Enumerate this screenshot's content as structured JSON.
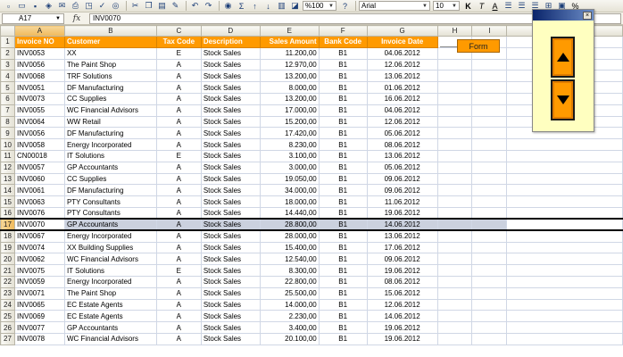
{
  "toolbar": {
    "zoom": "%100",
    "font": "Arial",
    "size": "10",
    "icons": [
      "new-icon",
      "open-icon",
      "save-icon",
      "permission-icon",
      "email-icon",
      "print-icon",
      "print-preview-icon",
      "spelling-icon",
      "research-icon",
      "cut-icon",
      "copy-icon",
      "paste-icon",
      "format-painter-icon",
      "undo-icon",
      "redo-icon",
      "hyperlink-icon",
      "autosum-icon",
      "sort-ascending-icon",
      "sort-descending-icon",
      "chart-wizard-icon",
      "drawing-icon",
      "help-icon"
    ],
    "bold": "K",
    "italic": "T",
    "underline": "A",
    "percent": "%"
  },
  "formula_bar": {
    "name_box": "A17",
    "fx": "fx",
    "formula": "INV0070"
  },
  "columns": [
    "A",
    "B",
    "C",
    "D",
    "E",
    "F",
    "G",
    "H",
    "I"
  ],
  "header_row": {
    "row_num": "1",
    "cells": [
      "Invoice NO",
      "Customer",
      "Tax Code",
      "Description",
      "Sales Amount",
      "Bank Code",
      "Invoice Date",
      "",
      ""
    ]
  },
  "rows": [
    {
      "n": "2",
      "cells": [
        "INV0053",
        "XX",
        "E",
        "Stock Sales",
        "11.200,00",
        "B1",
        "04.06.2012"
      ]
    },
    {
      "n": "3",
      "cells": [
        "INV0056",
        "The Paint Shop",
        "A",
        "Stock Sales",
        "12.970,00",
        "B1",
        "12.06.2012"
      ]
    },
    {
      "n": "4",
      "cells": [
        "INV0068",
        "TRF Solutions",
        "A",
        "Stock Sales",
        "13.200,00",
        "B1",
        "13.06.2012"
      ]
    },
    {
      "n": "5",
      "cells": [
        "INV0051",
        "DF Manufacturing",
        "A",
        "Stock Sales",
        "8.000,00",
        "B1",
        "01.06.2012"
      ]
    },
    {
      "n": "6",
      "cells": [
        "INV0073",
        "CC Supplies",
        "A",
        "Stock Sales",
        "13.200,00",
        "B1",
        "16.06.2012"
      ]
    },
    {
      "n": "7",
      "cells": [
        "INV0055",
        "WC Financial Advisors",
        "A",
        "Stock Sales",
        "17.000,00",
        "B1",
        "04.06.2012"
      ]
    },
    {
      "n": "8",
      "cells": [
        "INV0064",
        "WW Retail",
        "A",
        "Stock Sales",
        "15.200,00",
        "B1",
        "12.06.2012"
      ]
    },
    {
      "n": "9",
      "cells": [
        "INV0056",
        "DF Manufacturing",
        "A",
        "Stock Sales",
        "17.420,00",
        "B1",
        "05.06.2012"
      ]
    },
    {
      "n": "10",
      "cells": [
        "INV0058",
        "Energy Incorporated",
        "A",
        "Stock Sales",
        "8.230,00",
        "B1",
        "08.06.2012"
      ]
    },
    {
      "n": "11",
      "cells": [
        "CN00018",
        "IT Solutions",
        "E",
        "Stock Sales",
        "3.100,00",
        "B1",
        "13.06.2012"
      ]
    },
    {
      "n": "12",
      "cells": [
        "INV0057",
        "GP Accountants",
        "A",
        "Stock Sales",
        "3.000,00",
        "B1",
        "05.06.2012"
      ]
    },
    {
      "n": "13",
      "cells": [
        "INV0060",
        "CC Supplies",
        "A",
        "Stock Sales",
        "19.050,00",
        "B1",
        "09.06.2012"
      ]
    },
    {
      "n": "14",
      "cells": [
        "INV0061",
        "DF Manufacturing",
        "A",
        "Stock Sales",
        "34.000,00",
        "B1",
        "09.06.2012"
      ]
    },
    {
      "n": "15",
      "cells": [
        "INV0063",
        "PTY Consultants",
        "A",
        "Stock Sales",
        "18.000,00",
        "B1",
        "11.06.2012"
      ]
    },
    {
      "n": "16",
      "cells": [
        "INV0076",
        "PTY Consultants",
        "A",
        "Stock Sales",
        "14.440,00",
        "B1",
        "19.06.2012"
      ]
    },
    {
      "n": "17",
      "cells": [
        "INV0070",
        "GP Accountants",
        "A",
        "Stock Sales",
        "28.800,00",
        "B1",
        "14.06.2012"
      ],
      "selected": true
    },
    {
      "n": "18",
      "cells": [
        "INV0067",
        "Energy Incorporated",
        "A",
        "Stock Sales",
        "28.000,00",
        "B1",
        "13.06.2012"
      ]
    },
    {
      "n": "19",
      "cells": [
        "INV0074",
        "XX Building Supplies",
        "A",
        "Stock Sales",
        "15.400,00",
        "B1",
        "17.06.2012"
      ]
    },
    {
      "n": "20",
      "cells": [
        "INV0062",
        "WC Financial Advisors",
        "A",
        "Stock Sales",
        "12.540,00",
        "B1",
        "09.06.2012"
      ]
    },
    {
      "n": "21",
      "cells": [
        "INV0075",
        "IT Solutions",
        "E",
        "Stock Sales",
        "8.300,00",
        "B1",
        "19.06.2012"
      ]
    },
    {
      "n": "22",
      "cells": [
        "INV0059",
        "Energy Incorporated",
        "A",
        "Stock Sales",
        "22.800,00",
        "B1",
        "08.06.2012"
      ]
    },
    {
      "n": "23",
      "cells": [
        "INV0071",
        "The Paint Shop",
        "A",
        "Stock Sales",
        "25.500,00",
        "B1",
        "15.06.2012"
      ]
    },
    {
      "n": "24",
      "cells": [
        "INV0065",
        "EC Estate Agents",
        "A",
        "Stock Sales",
        "14.000,00",
        "B1",
        "12.06.2012"
      ]
    },
    {
      "n": "25",
      "cells": [
        "INV0069",
        "EC Estate Agents",
        "A",
        "Stock Sales",
        "2.230,00",
        "B1",
        "14.06.2012"
      ]
    },
    {
      "n": "26",
      "cells": [
        "INV0077",
        "GP Accountants",
        "A",
        "Stock Sales",
        "3.400,00",
        "B1",
        "19.06.2012"
      ]
    },
    {
      "n": "27",
      "cells": [
        "INV0078",
        "WC Financial Advisors",
        "A",
        "Stock Sales",
        "20.100,00",
        "B1",
        "19.06.2012"
      ]
    }
  ],
  "form_button": "Form",
  "palette": {
    "close": "×"
  },
  "colors": {
    "header_orange": "#ff9a00",
    "selection": "#cbd1de"
  }
}
